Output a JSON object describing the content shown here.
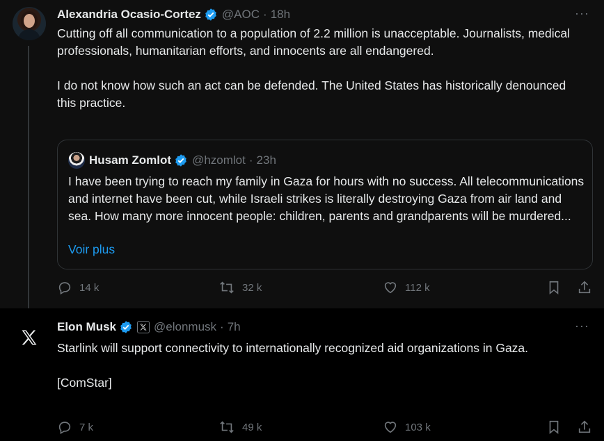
{
  "tweet1": {
    "author_name": "Alexandria Ocasio-Cortez",
    "handle": "@AOC",
    "separator": "·",
    "time": "18h",
    "more": "···",
    "text": "Cutting off all communication to a population of 2.2 million is unacceptable. Journalists, medical professionals, humanitarian efforts, and innocents are all endangered.\n\nI do not know how such an act can be defended. The United States has historically denounced this practice.",
    "quote": {
      "author_name": "Husam Zomlot",
      "handle": "@hzomlot",
      "separator": "·",
      "time": "23h",
      "text": "I have been trying to reach my family in Gaza for hours with no success. All telecommunications and internet have been cut, while Israeli strikes is literally destroying Gaza from air land and sea. How many more innocent people: children, parents and grandparents will be murdered...",
      "show_more": "Voir plus"
    },
    "actions": {
      "replies": "14 k",
      "reposts": "32 k",
      "likes": "112 k"
    }
  },
  "tweet2": {
    "author_name": "Elon Musk",
    "handle": "@elonmusk",
    "separator": "·",
    "time": "7h",
    "more": "···",
    "text": "Starlink will support connectivity to internationally recognized aid organizations in Gaza.\n\n[ComStar]",
    "actions": {
      "replies": "7 k",
      "reposts": "49 k",
      "likes": "103 k"
    }
  },
  "colors": {
    "background": "#000000",
    "text": "#e7e9ea",
    "secondary": "#71767b",
    "link": "#1d9bf0",
    "verified": "#1d9bf0",
    "border": "#2f3336"
  }
}
